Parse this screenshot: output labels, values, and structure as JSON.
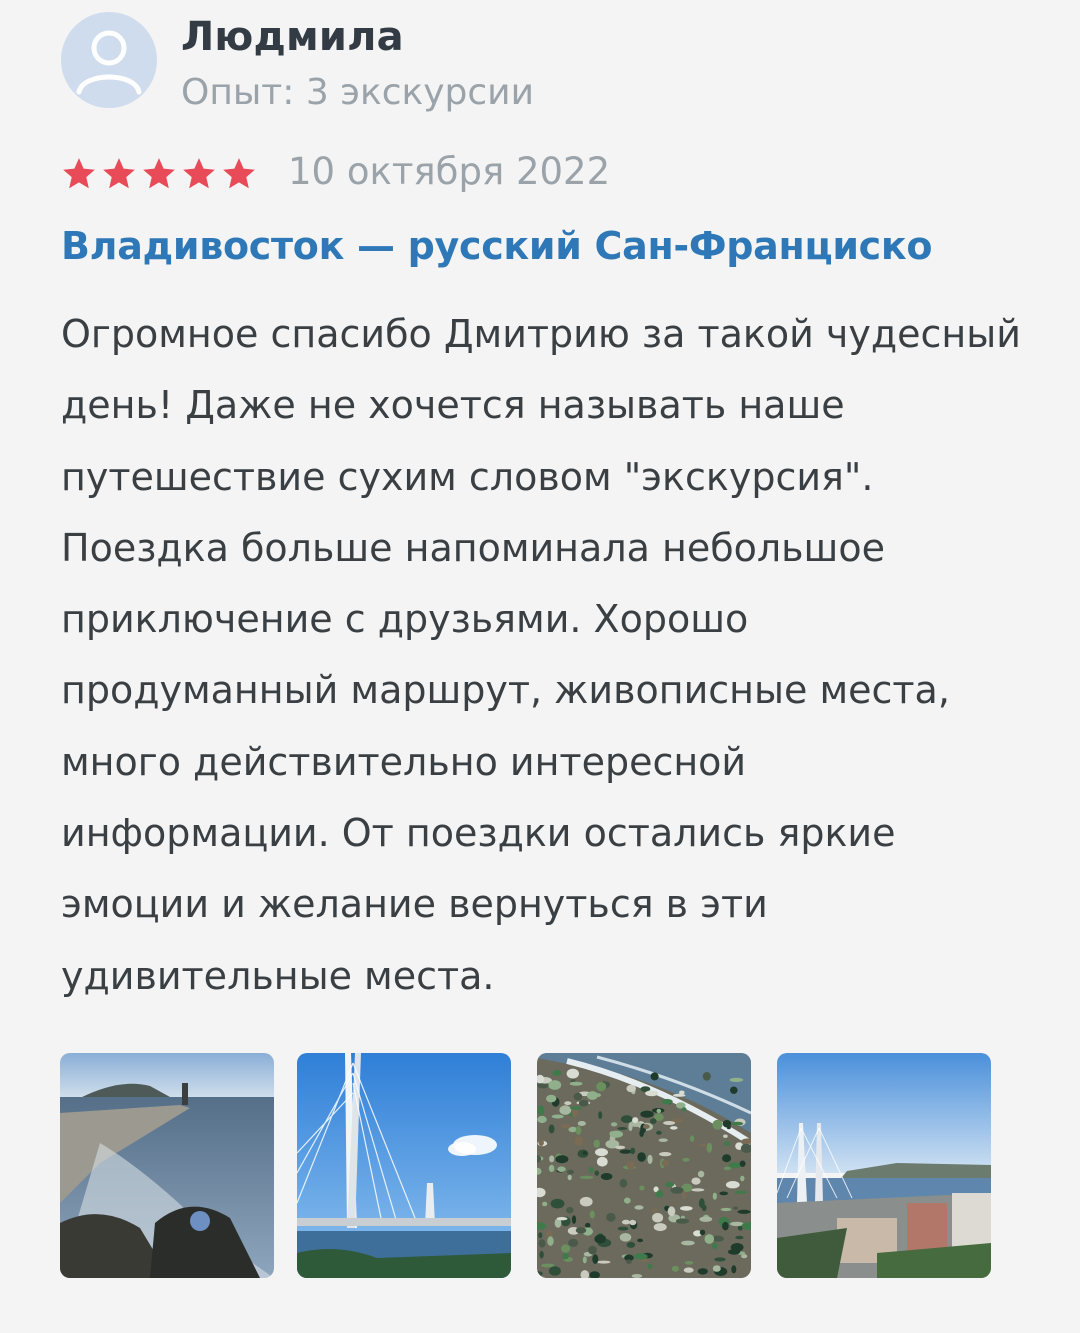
{
  "author": {
    "name": "Людмила",
    "experience": "Опыт: 3 экскурсии",
    "avatar_icon": "user-avatar-icon"
  },
  "review": {
    "rating": 5,
    "rating_max": 5,
    "date": "10 октября 2022",
    "title": "Владивосток — русский Сан-Франциско",
    "text": "Огромное спасибо Дмитрию за такой чудесный день! Даже не хочется называть наше путешествие сухим словом \"экскурсия\". Поездка больше напоминала небольшое приключение с друзьями. Хорошо продуманный маршрут, живописные места, много действительно интересной информации. От поездки остались яркие эмоции и желание вернуться в эти удивительные места."
  },
  "photos": [
    {
      "name": "photo-causeway-lighthouse"
    },
    {
      "name": "photo-russky-bridge"
    },
    {
      "name": "photo-glass-beach"
    },
    {
      "name": "photo-golden-bridge-city"
    }
  ],
  "colors": {
    "star": "#e94a57",
    "title": "#2f78b8",
    "muted": "#9aa2aa",
    "background": "#f3f4f3"
  }
}
